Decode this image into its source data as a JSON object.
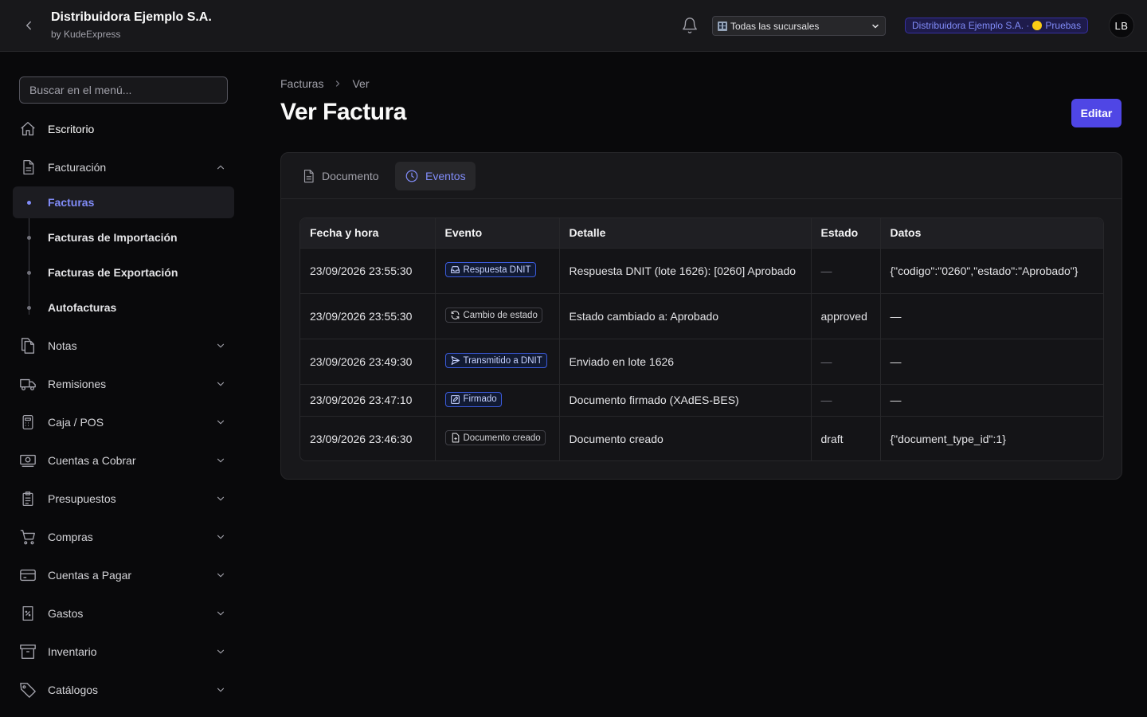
{
  "header": {
    "title": "Distribuidora Ejemplo S.A.",
    "subtitle": "by KudeExpress",
    "branch_selected": "Todas las sucursales",
    "company_badge_name": "Distribuidora Ejemplo S.A. ·",
    "company_badge_env": "Pruebas",
    "avatar_initials": "LB"
  },
  "sidebar": {
    "search_placeholder": "Buscar en el menú...",
    "items": [
      {
        "label": "Escritorio",
        "icon": "home-icon"
      },
      {
        "label": "Facturación",
        "icon": "document-icon",
        "expanded": true
      },
      {
        "label": "Notas",
        "icon": "files-icon"
      },
      {
        "label": "Remisiones",
        "icon": "truck-icon"
      },
      {
        "label": "Caja / POS",
        "icon": "calculator-icon"
      },
      {
        "label": "Cuentas a Cobrar",
        "icon": "cash-icon"
      },
      {
        "label": "Presupuestos",
        "icon": "clipboard-icon"
      },
      {
        "label": "Compras",
        "icon": "cart-icon"
      },
      {
        "label": "Cuentas a Pagar",
        "icon": "credit-card-icon"
      },
      {
        "label": "Gastos",
        "icon": "receipt-percent-icon"
      },
      {
        "label": "Inventario",
        "icon": "archive-icon"
      },
      {
        "label": "Catálogos",
        "icon": "tag-icon"
      }
    ],
    "subitems": [
      {
        "label": "Facturas",
        "active": true
      },
      {
        "label": "Facturas de Importación"
      },
      {
        "label": "Facturas de Exportación"
      },
      {
        "label": "Autofacturas"
      }
    ]
  },
  "breadcrumb": [
    "Facturas",
    "Ver"
  ],
  "page_title": "Ver Factura",
  "edit_label": "Editar",
  "tabs": [
    {
      "label": "Documento",
      "icon": "document-icon"
    },
    {
      "label": "Eventos",
      "icon": "clock-icon",
      "active": true
    }
  ],
  "events_table": {
    "headers": [
      "Fecha y hora",
      "Evento",
      "Detalle",
      "Estado",
      "Datos"
    ],
    "rows": [
      {
        "fecha": "23/09/2026 23:55:30",
        "evento": "Respuesta DNIT",
        "evento_icon": "inbox-icon",
        "detalle": "Respuesta DNIT (lote 1626): [0260] Aprobado",
        "estado": "—",
        "datos": "{\"codigo\":\"0260\",\"estado\":\"Aprobado\"}"
      },
      {
        "fecha": "23/09/2026 23:55:30",
        "evento": "Cambio de estado",
        "evento_icon": "refresh-icon",
        "detalle": "Estado cambiado a: Aprobado",
        "estado": "approved",
        "datos": "—"
      },
      {
        "fecha": "23/09/2026 23:49:30",
        "evento": "Transmitido a DNIT",
        "evento_icon": "send-icon",
        "detalle": "Enviado en lote 1626",
        "estado": "—",
        "datos": "—"
      },
      {
        "fecha": "23/09/2026 23:47:10",
        "evento": "Firmado",
        "evento_icon": "pen-icon",
        "detalle": "Documento firmado (XAdES-BES)",
        "estado": "—",
        "datos": "—"
      },
      {
        "fecha": "23/09/2026 23:46:30",
        "evento": "Documento creado",
        "evento_icon": "document-plus-icon",
        "detalle": "Documento creado",
        "estado": "draft",
        "datos": "{\"document_type_id\":1}"
      }
    ]
  },
  "colors": {
    "accent": "#4f46e5",
    "accent_text": "#818cf8",
    "background": "#09090b",
    "surface": "#18181b",
    "border": "#27272a"
  }
}
